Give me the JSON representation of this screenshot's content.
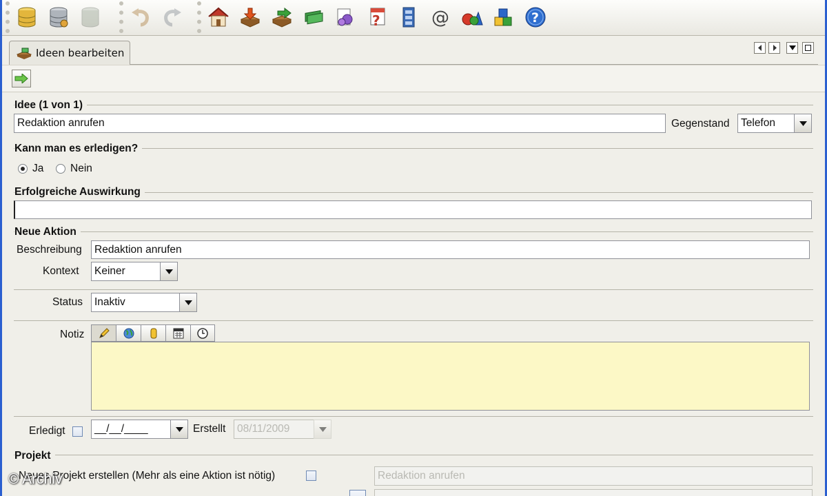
{
  "toolbar": {
    "icons": [
      "database-icon",
      "database-settings-icon",
      "database-disabled-icon",
      "undo-icon",
      "redo-icon",
      "home-icon",
      "inbox-import-icon",
      "process-icon",
      "money-icon",
      "gears-icon",
      "calendar-help-icon",
      "filing-cabinet-icon",
      "email-at-icon",
      "shapes-icon",
      "blocks-icon",
      "help-icon"
    ]
  },
  "tab": {
    "label": "Ideen bearbeiten"
  },
  "idee": {
    "title": "Idee (1 von 1)",
    "value": "Redaktion anrufen",
    "gegenstand_label": "Gegenstand",
    "gegenstand_value": "Telefon"
  },
  "erledigen": {
    "title": "Kann man es erledigen?",
    "ja": "Ja",
    "nein": "Nein",
    "selected": "Ja"
  },
  "auswirkung": {
    "title": "Erfolgreiche Auswirkung",
    "value": ""
  },
  "aktion": {
    "title": "Neue Aktion",
    "beschreibung_label": "Beschreibung",
    "beschreibung_value": "Redaktion anrufen",
    "kontext_label": "Kontext",
    "kontext_value": "Keiner",
    "status_label": "Status",
    "status_value": "Inaktiv",
    "notiz_label": "Notiz",
    "notiz_tools": [
      "pencil-icon",
      "globe-icon",
      "file-icon",
      "calendar-icon",
      "clock-icon"
    ],
    "erledigt_label": "Erledigt",
    "erledigt_date": "__/__/____",
    "erstellt_label": "Erstellt",
    "erstellt_date": "08/11/2009"
  },
  "projekt": {
    "title": "Projekt",
    "neues_label": "Neues Projekt erstellen (Mehr als eine Aktion ist nötig)",
    "name_value": "Redaktion anrufen"
  },
  "watermark": "© Archiv"
}
